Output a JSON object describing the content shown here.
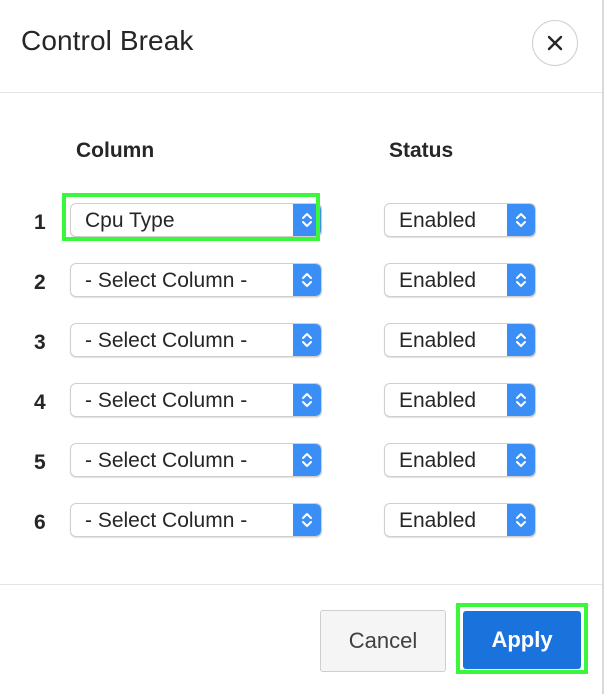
{
  "dialog": {
    "title": "Control Break",
    "close_icon": "close-icon"
  },
  "columns": {
    "column_header": "Column",
    "status_header": "Status"
  },
  "rows": [
    {
      "num": "1",
      "column": "Cpu Type",
      "status": "Enabled"
    },
    {
      "num": "2",
      "column": "- Select Column -",
      "status": "Enabled"
    },
    {
      "num": "3",
      "column": "- Select Column -",
      "status": "Enabled"
    },
    {
      "num": "4",
      "column": "- Select Column -",
      "status": "Enabled"
    },
    {
      "num": "5",
      "column": "- Select Column -",
      "status": "Enabled"
    },
    {
      "num": "6",
      "column": "- Select Column -",
      "status": "Enabled"
    }
  ],
  "footer": {
    "cancel_label": "Cancel",
    "apply_label": "Apply"
  },
  "colors": {
    "accent": "#1a73dc",
    "select_arrow": "#3a8ef6",
    "highlight": "#3bf73b"
  }
}
